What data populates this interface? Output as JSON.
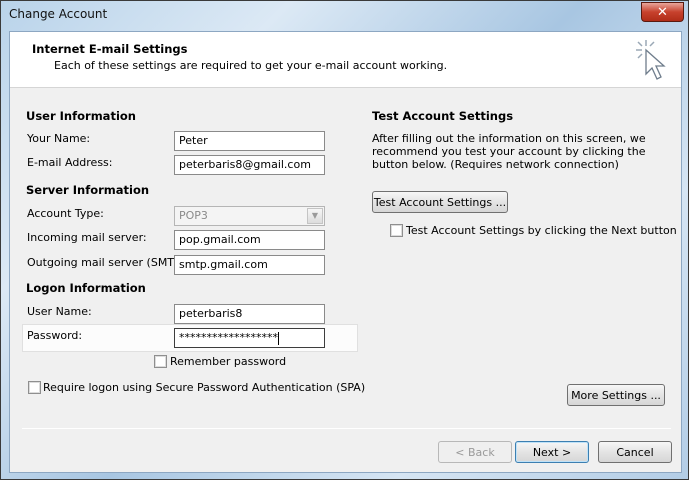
{
  "window": {
    "title": "Change Account",
    "close_glyph": "✕"
  },
  "header": {
    "title": "Internet E-mail Settings",
    "subtitle": "Each of these settings are required to get your e-mail account working."
  },
  "user_info": {
    "heading": "User Information",
    "your_name_label": "Your Name:",
    "your_name_value": "Peter",
    "email_label": "E-mail Address:",
    "email_value": "peterbaris8@gmail.com"
  },
  "server_info": {
    "heading": "Server Information",
    "account_type_label": "Account Type:",
    "account_type_value": "POP3",
    "incoming_label": "Incoming mail server:",
    "incoming_value": "pop.gmail.com",
    "outgoing_label": "Outgoing mail server (SMTP):",
    "outgoing_value": "smtp.gmail.com"
  },
  "logon_info": {
    "heading": "Logon Information",
    "user_name_label": "User Name:",
    "user_name_value": "peterbaris8",
    "password_label": "Password:",
    "password_value": "******************",
    "remember_label": "Remember password",
    "remember_checked": false,
    "spa_label": "Require logon using Secure Password Authentication (SPA)",
    "spa_checked": false
  },
  "test_settings": {
    "heading": "Test Account Settings",
    "description": "After filling out the information on this screen, we recommend you test your account by clicking the button below. (Requires network connection)",
    "test_button": "Test Account Settings ...",
    "auto_test_label": "Test Account Settings by clicking the Next button",
    "auto_test_checked": false
  },
  "buttons": {
    "more_settings": "More Settings ...",
    "back": "< Back",
    "next": "Next >",
    "cancel": "Cancel"
  },
  "icons": {
    "header_icon": "mouse-cursor-click-icon",
    "combo_arrow": "chevron-down-icon"
  }
}
